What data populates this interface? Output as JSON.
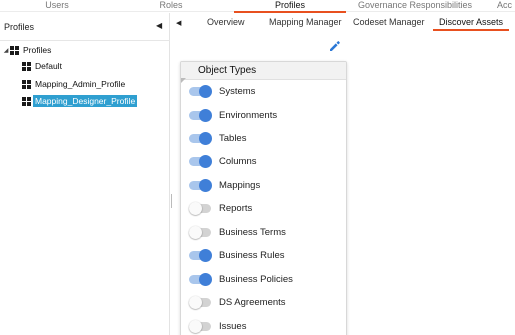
{
  "top_tabs": [
    {
      "label": "Users",
      "active": false
    },
    {
      "label": "Roles",
      "active": false
    },
    {
      "label": "Profiles",
      "active": true
    },
    {
      "label": "Governance Responsibilities",
      "active": false
    },
    {
      "label": "Acc",
      "active": false
    }
  ],
  "left_pane": {
    "title": "Profiles",
    "collapse_icon": "chevron-left-icon",
    "tree": {
      "root": {
        "label": "Profiles",
        "expander_glyph": "◢",
        "icon": "profile-group-icon"
      },
      "children": [
        {
          "label": "Default",
          "icon": "profile-icon",
          "selected": false
        },
        {
          "label": "Mapping_Admin_Profile",
          "icon": "profile-icon",
          "selected": false
        },
        {
          "label": "Mapping_Designer_Profile",
          "icon": "profile-icon",
          "selected": true
        }
      ]
    }
  },
  "right_pane": {
    "expand_icon": "chevron-left-icon",
    "sub_tabs": [
      {
        "label": "Overview",
        "active": false
      },
      {
        "label": "Mapping Manager",
        "active": false
      },
      {
        "label": "Codeset Manager",
        "active": false
      },
      {
        "label": "Discover Assets",
        "active": true
      }
    ],
    "edit_icon": "pencil-icon",
    "object_types": {
      "title": "Object Types",
      "items": [
        {
          "label": "Systems",
          "enabled": true
        },
        {
          "label": "Environments",
          "enabled": true
        },
        {
          "label": "Tables",
          "enabled": true
        },
        {
          "label": "Columns",
          "enabled": true
        },
        {
          "label": "Mappings",
          "enabled": true
        },
        {
          "label": "Reports",
          "enabled": false
        },
        {
          "label": "Business Terms",
          "enabled": false
        },
        {
          "label": "Business Rules",
          "enabled": true
        },
        {
          "label": "Business Policies",
          "enabled": true
        },
        {
          "label": "DS Agreements",
          "enabled": false
        },
        {
          "label": "Issues",
          "enabled": false
        }
      ]
    }
  },
  "colors": {
    "accent_underline": "#e8501f",
    "toggle_on_knob": "#3f7fd8",
    "toggle_on_track": "#a9c6ec",
    "selected_node_bg": "#2f9fd0"
  }
}
